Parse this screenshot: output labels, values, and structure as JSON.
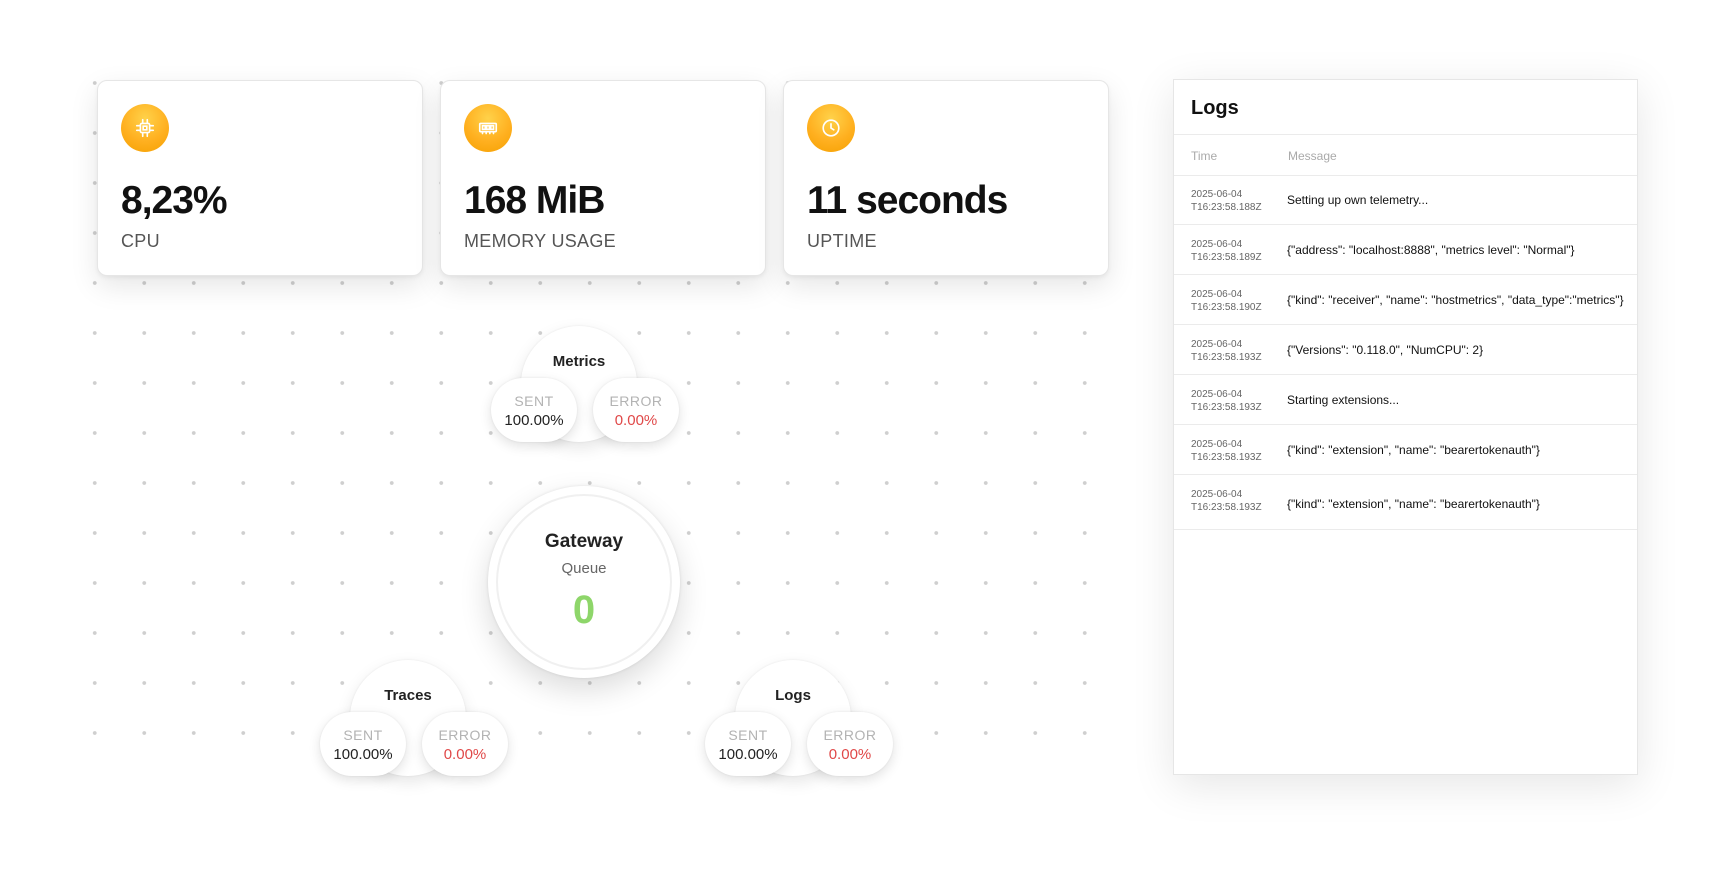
{
  "stats": [
    {
      "value": "8,23%",
      "label": "CPU",
      "icon": "cpu-chip-icon"
    },
    {
      "value": "168 MiB",
      "label": "MEMORY USAGE",
      "icon": "memory-module-icon"
    },
    {
      "value": "11 seconds",
      "label": "UPTIME",
      "icon": "clock-icon"
    }
  ],
  "flow": {
    "metrics": {
      "title": "Metrics",
      "sent_label": "SENT",
      "sent_value": "100.00%",
      "error_label": "ERROR",
      "error_value": "0.00%"
    },
    "gateway": {
      "title": "Gateway",
      "subtitle": "Queue",
      "value": "0"
    },
    "traces": {
      "title": "Traces",
      "sent_label": "SENT",
      "sent_value": "100.00%",
      "error_label": "ERROR",
      "error_value": "0.00%"
    },
    "logs": {
      "title": "Logs",
      "sent_label": "SENT",
      "sent_value": "100.00%",
      "error_label": "ERROR",
      "error_value": "0.00%"
    }
  },
  "logs_panel": {
    "title": "Logs",
    "columns": {
      "time": "Time",
      "message": "Message"
    },
    "rows": [
      {
        "date": "2025-06-04",
        "time": "T16:23:58.188Z",
        "message": "Setting up own telemetry..."
      },
      {
        "date": "2025-06-04",
        "time": "T16:23:58.189Z",
        "message": "{\"address\": \"localhost:8888\", \"metrics level\": \"Normal\"}"
      },
      {
        "date": "2025-06-04",
        "time": "T16:23:58.190Z",
        "message": "{\"kind\": \"receiver\", \"name\": \"hostmetrics\", \"data_type\":\"metrics\"}"
      },
      {
        "date": "2025-06-04",
        "time": "T16:23:58.193Z",
        "message": "{\"Versions\": \"0.118.0\", \"NumCPU\": 2}"
      },
      {
        "date": "2025-06-04",
        "time": "T16:23:58.193Z",
        "message": "Starting extensions..."
      },
      {
        "date": "2025-06-04",
        "time": "T16:23:58.193Z",
        "message": "{\"kind\": \"extension\", \"name\": \"bearertokenauth\"}"
      },
      {
        "date": "2025-06-04",
        "time": "T16:23:58.193Z",
        "message": "{\"kind\": \"extension\", \"name\": \"bearertokenauth\"}"
      }
    ]
  },
  "colors": {
    "accent": "#ffb020",
    "queue_ok": "#8ed66a",
    "error": "#e04848"
  }
}
